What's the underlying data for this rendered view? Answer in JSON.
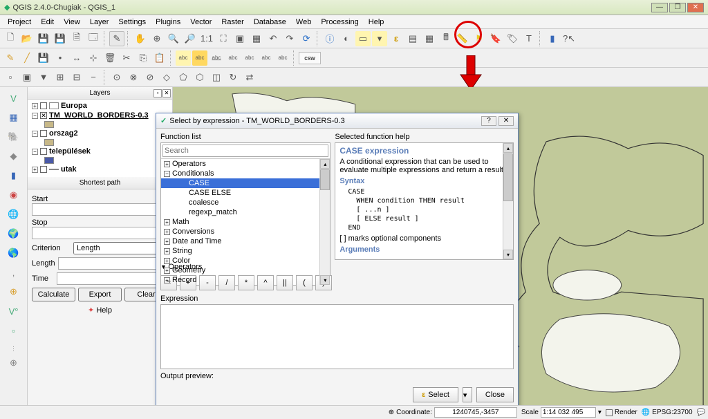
{
  "window": {
    "title": "QGIS 2.4.0-Chugiak - QGIS_1"
  },
  "menu": [
    "Project",
    "Edit",
    "View",
    "Layer",
    "Settings",
    "Plugins",
    "Vector",
    "Raster",
    "Database",
    "Web",
    "Processing",
    "Help"
  ],
  "layers_panel": {
    "title": "Layers",
    "items": [
      {
        "name": "Europa",
        "swatch": "#ffffff",
        "checked": false
      },
      {
        "name": "TM_WORLD_BORDERS-0.3",
        "swatch": "#c7b888",
        "checked": true,
        "bold": true,
        "underline": true
      },
      {
        "name": "orszag2",
        "swatch": "#c7b888",
        "checked": false
      },
      {
        "name": "települések",
        "swatch": "#4a5aa8",
        "checked": false
      },
      {
        "name": "utak",
        "swatch": "#ffffff",
        "checked": false
      }
    ]
  },
  "shortest_path": {
    "title": "Shortest path",
    "start": "Start",
    "stop": "Stop",
    "criterion_label": "Criterion",
    "criterion_value": "Length",
    "length_label": "Length",
    "time_label": "Time",
    "calculate": "Calculate",
    "export": "Export",
    "clear": "Clear",
    "help": "Help"
  },
  "dialog": {
    "title": "Select by expression - TM_WORLD_BORDERS-0.3",
    "function_list": "Function list",
    "help_label": "Selected function help",
    "search_placeholder": "Search",
    "tree": {
      "operators": "Operators",
      "conditionals": "Conditionals",
      "case": "CASE",
      "caseelse": "CASE ELSE",
      "coalesce": "coalesce",
      "regexp": "regexp_match",
      "math": "Math",
      "conversions": "Conversions",
      "datetime": "Date and Time",
      "string": "String",
      "color": "Color",
      "geometry": "Geometry",
      "record": "Record"
    },
    "help": {
      "heading": "CASE expression",
      "desc": "A conditional expression that can be used to evaluate multiple expressions and return a result.",
      "syntax": "Syntax",
      "code": "CASE\n  WHEN condition THEN result\n  [ ...n ]\n  [ ELSE result ]\nEND",
      "note": "[ ] marks optional components",
      "arguments": "Arguments"
    },
    "operators_header": "Operators",
    "op_buttons": [
      "=",
      "+",
      "-",
      "/",
      "*",
      "^",
      "||",
      "(",
      ")"
    ],
    "expression": "Expression",
    "output": "Output preview:",
    "select_btn": "Select",
    "close_btn": "Close"
  },
  "statusbar": {
    "coord_label": "Coordinate:",
    "coord_value": "1240745,-3457",
    "scale_label": "Scale",
    "scale_value": "1:14 032 495",
    "render": "Render",
    "epsg": "EPSG:23700"
  },
  "csw": "csw"
}
